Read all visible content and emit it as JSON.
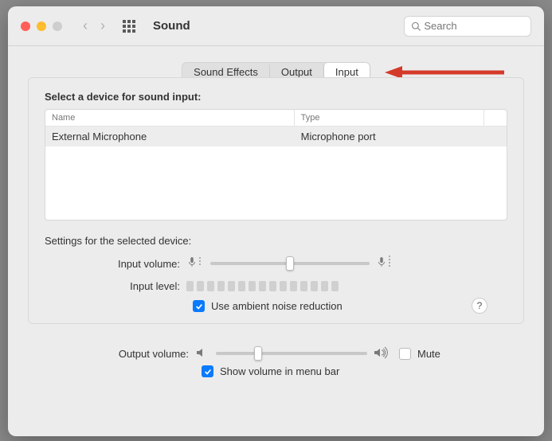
{
  "window": {
    "title": "Sound"
  },
  "search": {
    "placeholder": "Search"
  },
  "tabs": {
    "sound_effects": "Sound Effects",
    "output": "Output",
    "input": "Input"
  },
  "input_panel": {
    "select_label": "Select a device for sound input:",
    "columns": {
      "name": "Name",
      "type": "Type"
    },
    "rows": [
      {
        "name": "External Microphone",
        "type": "Microphone port"
      }
    ],
    "settings_label": "Settings for the selected device:",
    "input_volume_label": "Input volume:",
    "input_level_label": "Input level:",
    "noise_reduction_label": "Use ambient noise reduction",
    "help": "?"
  },
  "footer": {
    "output_volume_label": "Output volume:",
    "mute_label": "Mute",
    "show_menu_label": "Show volume in menu bar"
  },
  "state": {
    "input_volume_pct": 50,
    "output_volume_pct": 28,
    "noise_reduction_checked": true,
    "mute_checked": false,
    "show_menu_checked": true
  }
}
